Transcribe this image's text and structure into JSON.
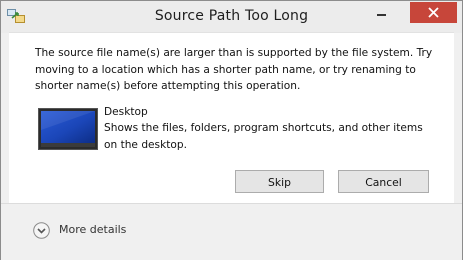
{
  "window": {
    "title": "Source Path Too Long"
  },
  "dialog": {
    "message": "The source file name(s) are larger than is supported by the file system. Try moving to a location which has a shorter path name, or try renaming to shorter name(s) before attempting this operation.",
    "item": {
      "icon": "desktop-icon",
      "name": "Desktop",
      "description": "Shows the files, folders, program shortcuts, and other items on the desktop."
    },
    "buttons": {
      "skip_label": "Skip",
      "cancel_label": "Cancel"
    }
  },
  "footer": {
    "more_details_label": "More details",
    "more_details_icon": "chevron-down-circle-icon"
  },
  "colors": {
    "close_button": "#c7463a",
    "content_background": "#ffffff",
    "chrome_background": "#f0f0f0"
  }
}
